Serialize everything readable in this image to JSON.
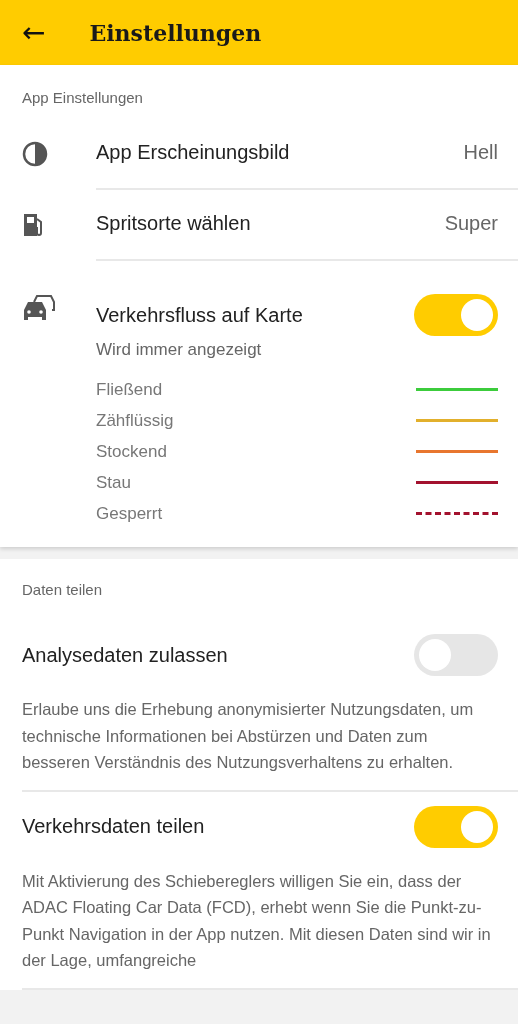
{
  "header": {
    "back": "←",
    "title": "Einstellungen"
  },
  "app_settings": {
    "label": "App Einstellungen",
    "items": [
      {
        "title": "App Erscheinungsbild",
        "value": "Hell"
      },
      {
        "title": "Spritsorte wählen",
        "value": "Super"
      }
    ],
    "traffic": {
      "title": "Verkehrsfluss auf Karte",
      "subtitle": "Wird immer angezeigt",
      "on": true,
      "legend": [
        {
          "label": "Fließend",
          "color": "#3ccc3c",
          "kind": "solid"
        },
        {
          "label": "Zähflüssig",
          "color": "#e2b02c",
          "kind": "solid"
        },
        {
          "label": "Stockend",
          "color": "#e8762e",
          "kind": "solid"
        },
        {
          "label": "Stau",
          "color": "#a3122e",
          "kind": "solid"
        },
        {
          "label": "Gesperrt",
          "color": "#a3122e",
          "kind": "dashed"
        }
      ]
    }
  },
  "data_sharing": {
    "label": "Daten teilen",
    "items": [
      {
        "title": "Analysedaten zulassen",
        "on": false,
        "description": "Erlaube uns die Erhebung anonymisierter Nutzungsdaten, um technische Informationen bei Abstürzen und Daten zum besseren Verständnis des Nutzungsverhaltens zu erhalten."
      },
      {
        "title": "Verkehrsdaten teilen",
        "on": true,
        "description": "Mit Aktivierung des Schiebereglers willigen Sie ein, dass der ADAC Floating Car Data (FCD), erhebt wenn Sie die Punkt-zu-Punkt Navigation in der App nutzen. Mit diesen Daten sind wir in der Lage, umfangreiche"
      }
    ]
  }
}
